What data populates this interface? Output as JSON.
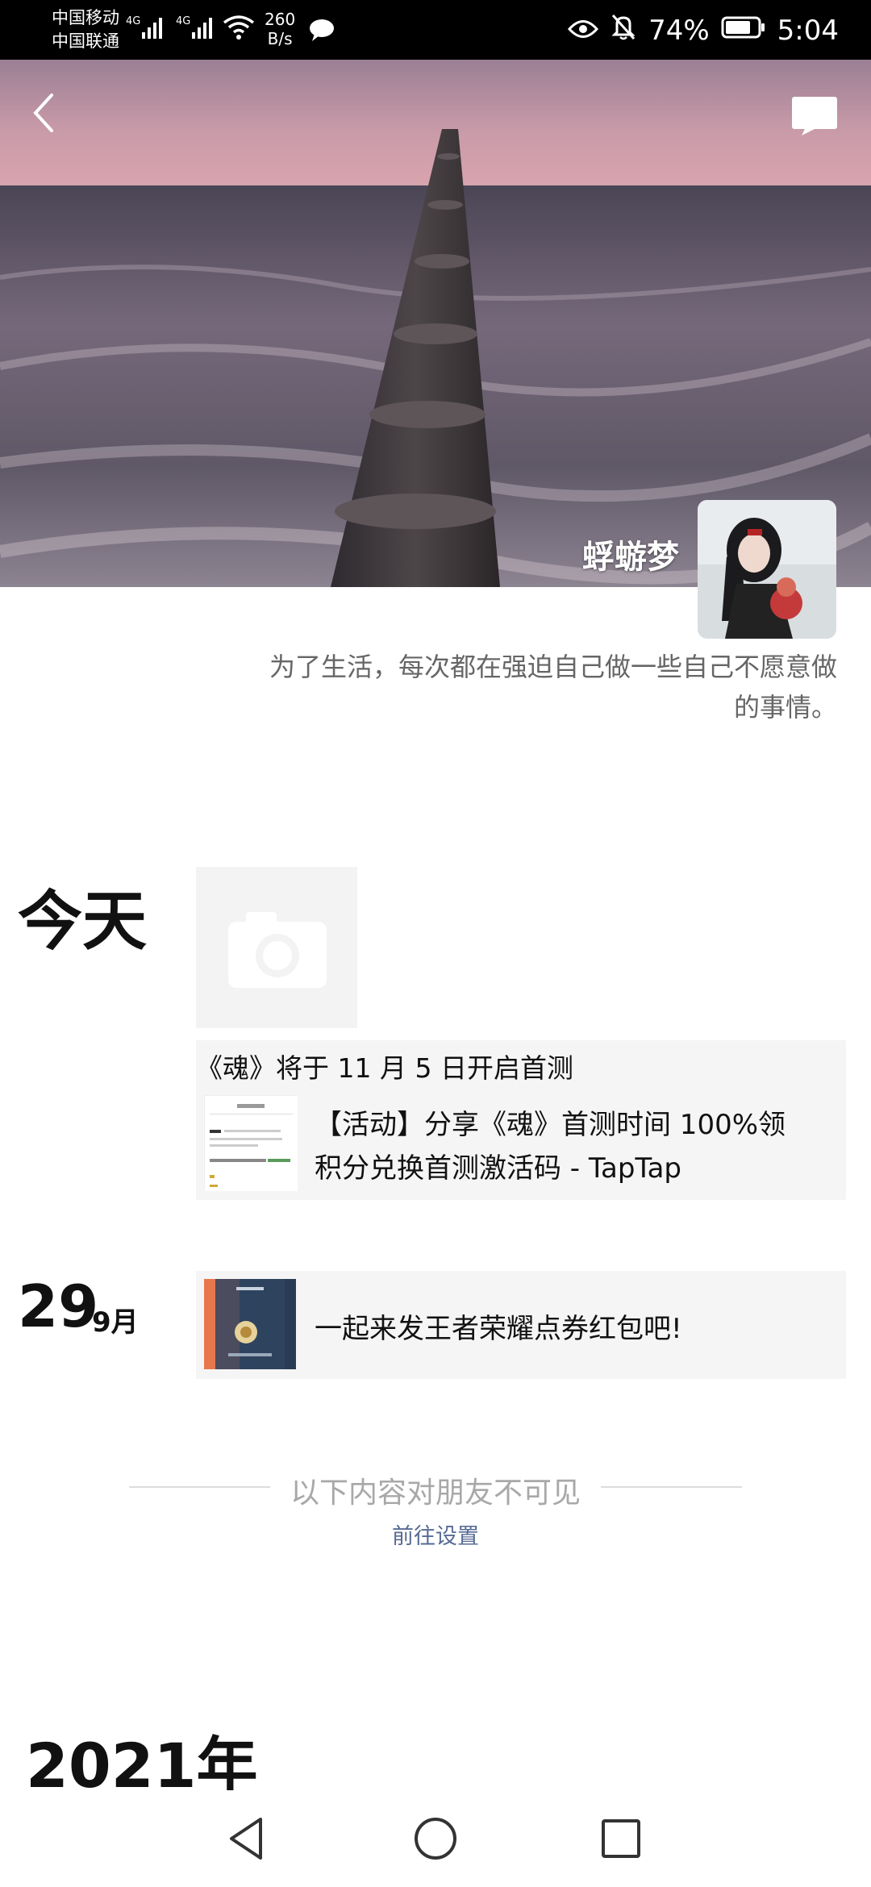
{
  "status_bar": {
    "carrier_1": "中国移动",
    "carrier_2": "中国联通",
    "net_1": "4G",
    "net_2": "4G",
    "speed_value": "260",
    "speed_unit": "B/s",
    "battery": "74%",
    "time": "5:04",
    "icons": [
      "signal-icon",
      "wifi-icon",
      "wechat-chat-icon",
      "eye-icon",
      "mute-bell-icon",
      "battery-icon"
    ]
  },
  "profile": {
    "username": "蜉蝣梦",
    "signature_line1": "为了生活，每次都在强迫自己做一些自己不愿意做",
    "signature_line2": "的事情。"
  },
  "timeline": {
    "today_label": "今天",
    "post1": {
      "title": "《魂》将于 11 月 5 日开启首测",
      "link_line1": "【活动】分享《魂》首测时间 100%领",
      "link_line2": "积分兑换首测激活码 - TapTap"
    },
    "day2": {
      "day": "29",
      "month": "9月"
    },
    "post2": {
      "text": "一起来发王者荣耀点券红包吧!"
    }
  },
  "hidden_notice": {
    "text": "以下内容对朋友不可见",
    "link": "前往设置"
  },
  "year_label": "2021年",
  "colors": {
    "link": "#576b95",
    "card_bg": "#f5f5f5",
    "muted_text": "#a8a8a8"
  }
}
